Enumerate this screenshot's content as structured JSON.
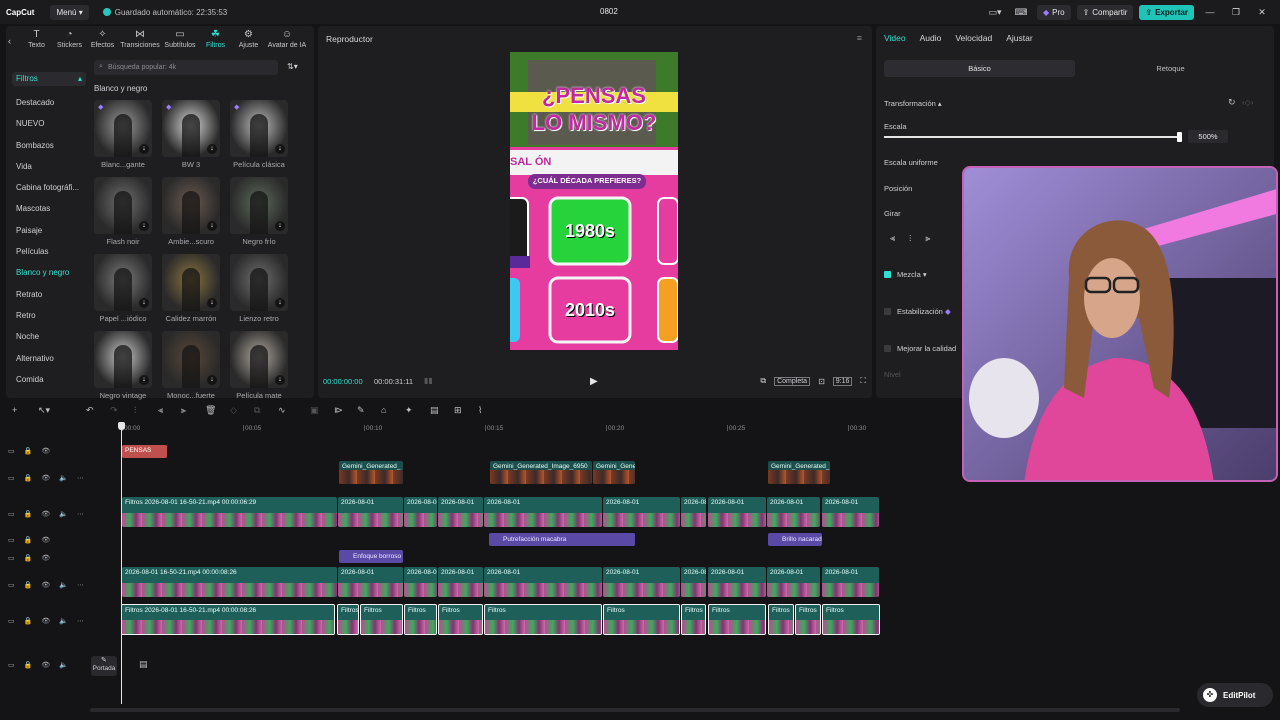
{
  "app": {
    "logo": "CapCut",
    "menu": "Menú",
    "autosave": "Guardado automático: 22:35:53",
    "project": "0802",
    "pro": "Pro",
    "share": "Compartir",
    "export": "Exportar"
  },
  "tools": [
    {
      "label": "Texto",
      "icon": "text-icon"
    },
    {
      "label": "Stickers",
      "icon": "sticker-icon"
    },
    {
      "label": "Efectos",
      "icon": "effects-icon"
    },
    {
      "label": "Transiciones",
      "icon": "transition-icon"
    },
    {
      "label": "Subtítulos",
      "icon": "subtitles-icon"
    },
    {
      "label": "Filtros",
      "icon": "filters-icon"
    },
    {
      "label": "Ajuste",
      "icon": "adjust-icon"
    },
    {
      "label": "Avatar de IA",
      "icon": "avatar-icon"
    }
  ],
  "categories": {
    "head": "Filtros",
    "items": [
      "Destacado",
      "NUEVO",
      "Bombazos",
      "Vida",
      "Cabina fotográfi...",
      "Mascotas",
      "Paisaje",
      "Películas",
      "Blanco y negro",
      "Retrato",
      "Retro",
      "Noche",
      "Alternativo",
      "Comida"
    ],
    "selected": "Blanco y negro"
  },
  "search_placeholder": "Búsqueda popular: 4k",
  "section_title": "Blanco y negro",
  "filters": [
    {
      "label": "Blanc...gante",
      "tone": "#9a9a9a"
    },
    {
      "label": "BW 3",
      "tone": "#d8d8d8"
    },
    {
      "label": "Película clásica",
      "tone": "#bdbdbd"
    },
    {
      "label": "Flash noir",
      "tone": "#6e6e6e"
    },
    {
      "label": "Ambie...scuro",
      "tone": "#6b5a50"
    },
    {
      "label": "Negro frío",
      "tone": "#5c6a5a"
    },
    {
      "label": "Papel ...iódico",
      "tone": "#7a7a7a"
    },
    {
      "label": "Calidez marrón",
      "tone": "#8a7440"
    },
    {
      "label": "Lienzo retro",
      "tone": "#6e6e6e"
    },
    {
      "label": "Negro vintage",
      "tone": "#c8c8c8"
    },
    {
      "label": "Monoc...fuerte",
      "tone": "#5a4838"
    },
    {
      "label": "Película mate",
      "tone": "#b0a8a0"
    }
  ],
  "player": {
    "title": "Reproductor",
    "time_current": "00:00:00:00",
    "time_total": "00:00:31:11",
    "full": "Completa",
    "ratio": "9:16",
    "video_lines": [
      "¿PENSAS",
      "LO MISMO?"
    ],
    "banner": "SAL        ÓN",
    "subtitle": "¿CUÁL DÉCADA PREFIERES?",
    "tiles": [
      "1980s",
      "2010s"
    ]
  },
  "props": {
    "tabs": [
      "Video",
      "Audio",
      "Velocidad",
      "Ajustar"
    ],
    "seg": [
      "Básico",
      "Retoque"
    ],
    "transform": "Transformación",
    "scale": "Escala",
    "scale_value": "500%",
    "uniform": "Escala uniforme",
    "position": "Posición",
    "rotate": "Girar",
    "blend": "Mezcla",
    "stabilize": "Estabilización",
    "quality": "Mejorar la calidad",
    "level": "Nivel"
  },
  "timeline": {
    "ruler": [
      "00:00",
      "00:05",
      "00:10",
      "00:15",
      "00:20",
      "00:25",
      "00:30"
    ],
    "text_clip": "PENSAS",
    "img_clips": [
      "Gemini_Generated_",
      "Gemini_Generated_Image_6950",
      "Gemini_Gene",
      "Gemini_Generated_"
    ],
    "fx_clips": [
      "Enfoque borroso",
      "Putrefacción macabra",
      "Brillo nacarad"
    ],
    "clip_a": "Filtros   2026-08-01 16-50-21.mp4   00:00:06:29",
    "clip_b": "2026-08-01 16-50-21.mp4   00:00:08:26",
    "clip_main": "Filtros   2026-08-01 16-50-21.mp4   00:00:08:26",
    "short": "2026-08-01",
    "filtros": "Filtros",
    "cover": "Portada"
  },
  "editpilot": "EditPilot",
  "colors": {
    "accent": "#2ee0cf",
    "export": "#1fc3b7",
    "fx": "#5a4aa6",
    "text_clip": "#c0504d"
  }
}
